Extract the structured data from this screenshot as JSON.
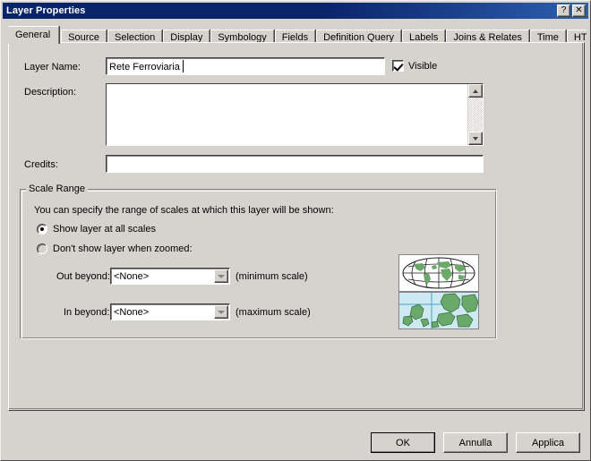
{
  "window": {
    "title": "Layer Properties",
    "help_button": "?",
    "close_button": "✕"
  },
  "tabs": [
    {
      "label": "General",
      "active": true
    },
    {
      "label": "Source",
      "active": false
    },
    {
      "label": "Selection",
      "active": false
    },
    {
      "label": "Display",
      "active": false
    },
    {
      "label": "Symbology",
      "active": false
    },
    {
      "label": "Fields",
      "active": false
    },
    {
      "label": "Definition Query",
      "active": false
    },
    {
      "label": "Labels",
      "active": false
    },
    {
      "label": "Joins & Relates",
      "active": false
    },
    {
      "label": "Time",
      "active": false
    },
    {
      "label": "HTML Popup",
      "active": false
    }
  ],
  "general": {
    "layer_name_label": "Layer Name:",
    "layer_name_value": "Rete Ferroviaria",
    "layer_name_placeholder": "",
    "visible_label": "Visible",
    "visible_checked": true,
    "description_label": "Description:",
    "description_value": "",
    "description_placeholder": "",
    "credits_label": "Credits:",
    "credits_value": "",
    "credits_placeholder": ""
  },
  "scale_range": {
    "legend": "Scale Range",
    "hint": "You can specify the range of scales at which this layer will be shown:",
    "radio_all_scales": "Show layer at all scales",
    "radio_when_zoomed": "Don't show layer when zoomed:",
    "selected_option": "all_scales",
    "out_beyond_label": "Out beyond:",
    "out_beyond_value": "<None>",
    "out_beyond_note": "(minimum scale)",
    "in_beyond_label": "In beyond:",
    "in_beyond_value": "<None>",
    "in_beyond_note": "(maximum scale)"
  },
  "footer": {
    "ok_label": "OK",
    "cancel_label": "Annulla",
    "apply_label": "Applica"
  },
  "colors": {
    "titlebar_start": "#0a246a",
    "titlebar_end": "#2d5fae",
    "dialog_face": "#d6d3ce",
    "field_bg": "#ffffff",
    "land_green": "#6aa96a",
    "sea_blue": "#cfe9f2",
    "grid_blue": "#4aa3c7"
  }
}
